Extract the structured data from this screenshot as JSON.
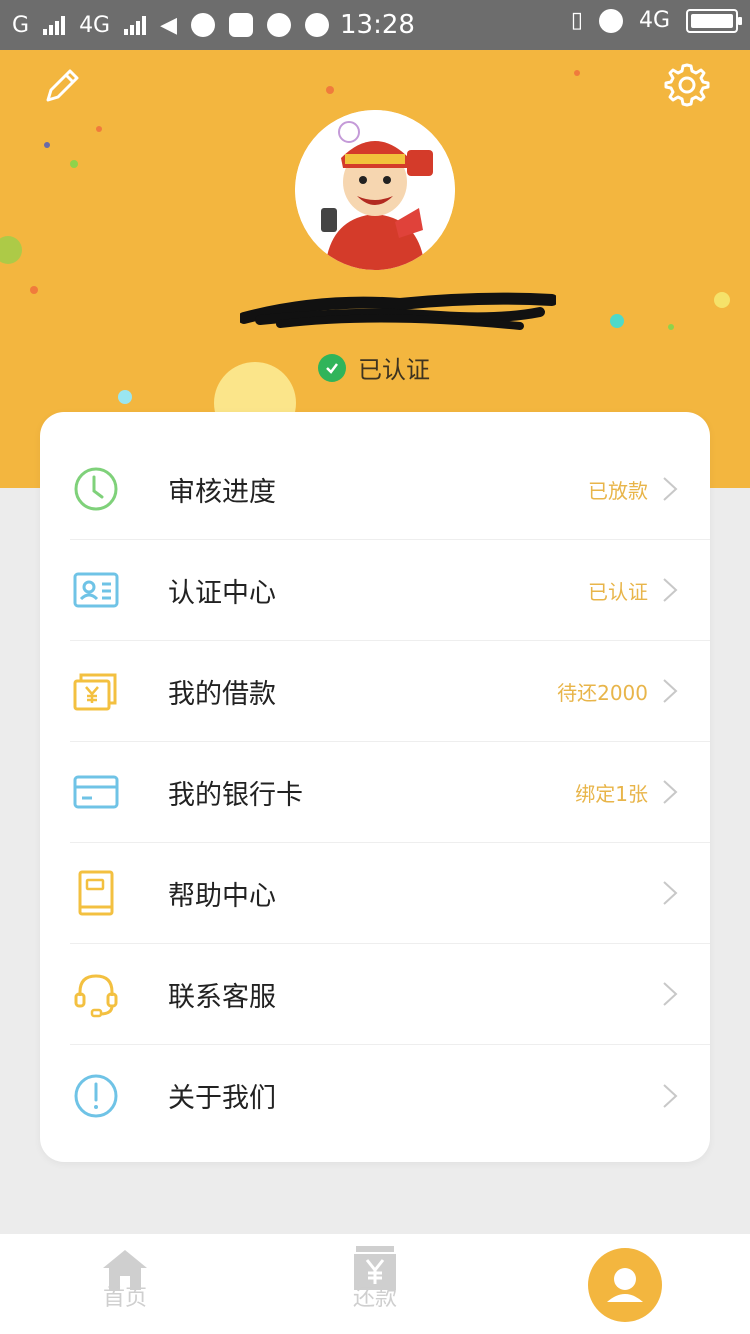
{
  "status_bar": {
    "carrier1": "G",
    "carrier2": "4G",
    "time": "13:28",
    "network": "4G"
  },
  "profile": {
    "verified_label": "已认证"
  },
  "menu": [
    {
      "label": "审核进度",
      "value": "已放款",
      "icon": "clock-icon"
    },
    {
      "label": "认证中心",
      "value": "已认证",
      "icon": "id-card-icon"
    },
    {
      "label": "我的借款",
      "value": "待还2000",
      "icon": "yen-wallet-icon"
    },
    {
      "label": "我的银行卡",
      "value": "绑定1张",
      "icon": "bank-card-icon"
    },
    {
      "label": "帮助中心",
      "value": "",
      "icon": "book-icon"
    },
    {
      "label": "联系客服",
      "value": "",
      "icon": "headset-icon"
    },
    {
      "label": "关于我们",
      "value": "",
      "icon": "info-icon"
    }
  ],
  "tabbar": {
    "home": "首页",
    "repay": "还款"
  },
  "colors": {
    "accent": "#f3b63f",
    "value_text": "#e8b54a",
    "green_icon": "#7fd17a",
    "blue_icon": "#6fc3e6",
    "verified_green": "#30b45a"
  }
}
